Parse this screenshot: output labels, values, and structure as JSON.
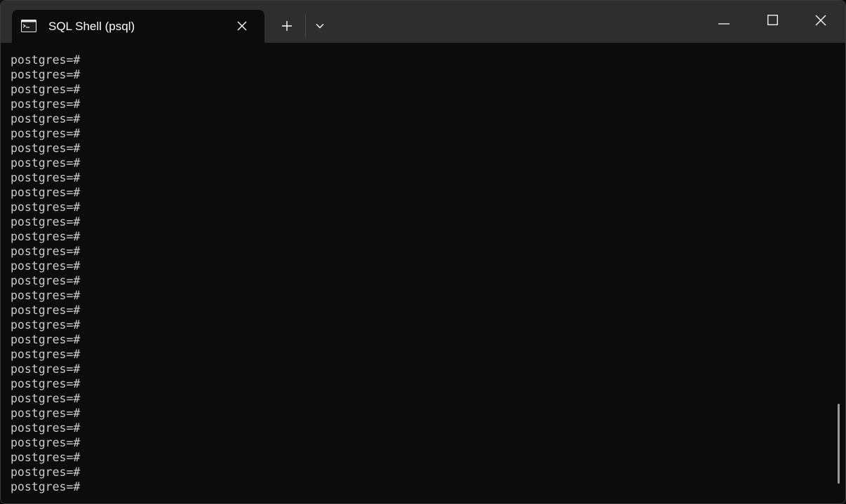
{
  "window": {
    "tab_title": "SQL Shell (psql)"
  },
  "terminal": {
    "lines": [
      "postgres=#",
      "postgres=#",
      "postgres=#",
      "postgres=#",
      "postgres=#",
      "postgres=#",
      "postgres=#",
      "postgres=#",
      "postgres=#",
      "postgres=#",
      "postgres=#",
      "postgres=#",
      "postgres=#",
      "postgres=#",
      "postgres=#",
      "postgres=#",
      "postgres=#",
      "postgres=#",
      "postgres=#",
      "postgres=#",
      "postgres=#",
      "postgres=#",
      "postgres=#",
      "postgres=#",
      "postgres=#",
      "postgres=#",
      "postgres=#",
      "postgres=#",
      "postgres=#",
      "postgres=#"
    ]
  },
  "icons": {
    "tab_icon": "console-icon",
    "tab_close": "close-icon",
    "new_tab": "plus-icon",
    "dropdown": "chevron-down-icon",
    "minimize": "minimize-icon",
    "maximize": "maximize-icon",
    "close": "close-icon"
  },
  "colors": {
    "terminal_bg": "#0c0c0c",
    "terminal_fg": "#cccccc",
    "titlebar_bg": "#2e2e2e"
  }
}
